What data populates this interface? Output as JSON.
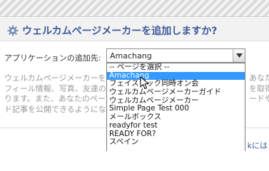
{
  "dialog": {
    "title": "ウェルカムページメーカーを追加しますか?",
    "app_select_label": "アプリケーションの追加先:",
    "selected_value": "Amachang",
    "description_left": [
      "ウェルカムページメーカーを",
      "フィール情報、写真、友達の",
      "ります。また、あなたのペー",
      "ド記事を公開できるようにな"
    ],
    "description_right": [
      "あなたの",
      "を取得",
      "ードやフ",
      ""
    ],
    "footer_link": "kには"
  },
  "dropdown": {
    "options": [
      "-- ページを選択 --",
      "Amachang",
      "フェイスブック同時オン会",
      "ウェルカムページメーカーガイド",
      "ウェルカムページメーカー",
      "Simple Page Test 000",
      "メールボックス",
      "readyfor test",
      "READY FOR?",
      "スペイン"
    ],
    "selected_index": 1
  },
  "colors": {
    "title": "#3b5998",
    "selected_option_bg": "#3399ff",
    "muted_text": "#999999"
  },
  "icons": {
    "header": "gear-icon",
    "select_arrow": "chevron-down-icon",
    "pointer": "cursor-icon"
  }
}
